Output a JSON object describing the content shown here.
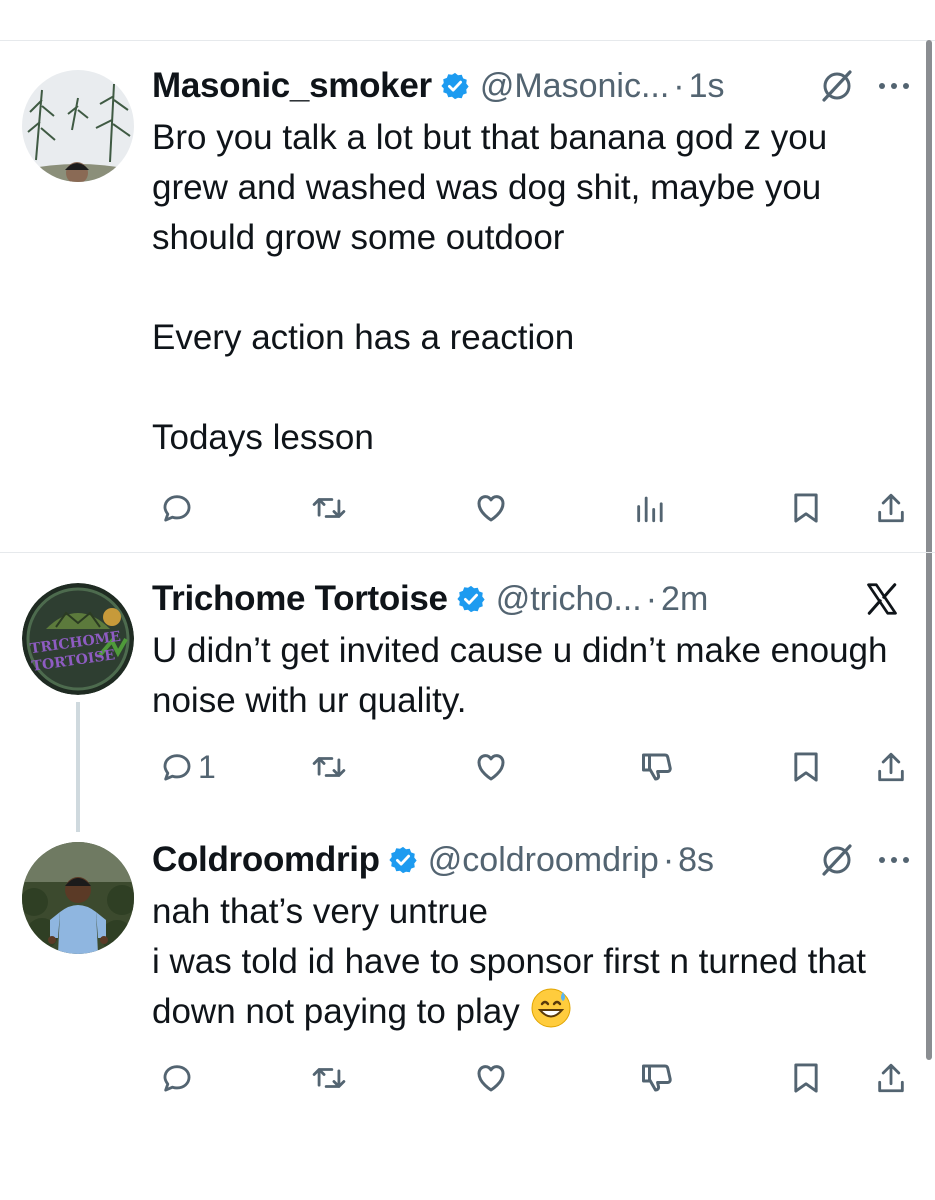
{
  "tweets": [
    {
      "name": "Masonic_smoker",
      "handle": "@Masonic...",
      "separator": "·",
      "time": "1s",
      "text": "Bro you talk a lot but that banana god z you grew and washed was dog shit, maybe you should grow some outdoor\n\nEvery action has a reaction\n\nTodays lesson",
      "reply_count": "",
      "icons": [
        "reply-icon",
        "retweet-icon",
        "like-icon",
        "views-icon",
        "bookmark-icon",
        "share-icon"
      ]
    },
    {
      "name": "Trichome Tortoise",
      "handle": "@tricho...",
      "separator": "·",
      "time": "2m",
      "avatar_text": "TRICHOME TORTOISE",
      "text": "U didn’t get invited cause u didn’t make enough noise with ur quality.",
      "reply_count": "1",
      "icons": [
        "reply-icon",
        "retweet-icon",
        "like-icon",
        "downvote-icon",
        "bookmark-icon",
        "share-icon"
      ]
    },
    {
      "name": "Coldroomdrip",
      "handle": "@coldroomdrip",
      "separator": "·",
      "time": "8s",
      "text": "nah that’s very untrue\ni was told id have to sponsor first n turned that down not paying to play",
      "emoji": "grinning-sweat-emoji",
      "reply_count": "",
      "icons": [
        "reply-icon",
        "retweet-icon",
        "like-icon",
        "downvote-icon",
        "bookmark-icon",
        "share-icon"
      ]
    }
  ],
  "colors": {
    "text": "#0f1419",
    "secondary": "#536471",
    "verified": "#1d9bf0",
    "divider": "#e6e9ec",
    "thread_line": "#cfd9de"
  }
}
